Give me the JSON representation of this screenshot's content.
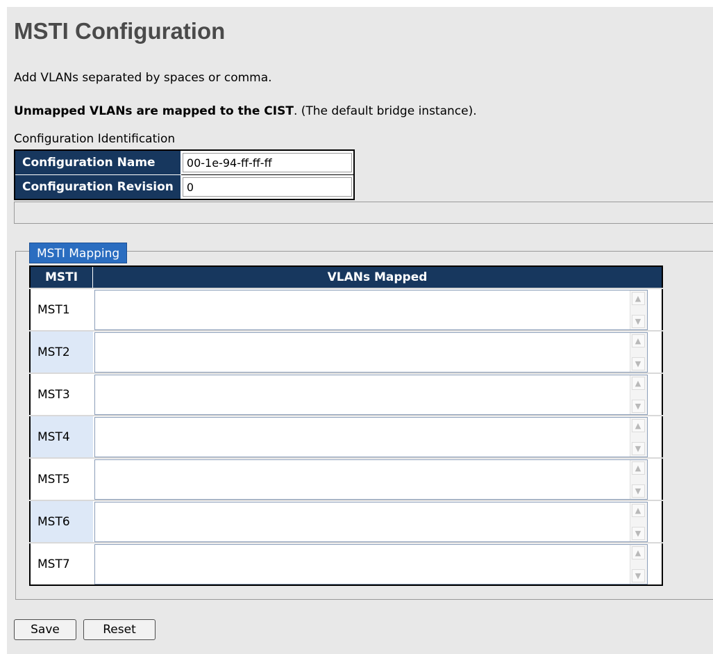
{
  "page": {
    "title": "MSTI Configuration",
    "note_add": "Add VLANs separated by spaces or comma.",
    "note_unmapped_bold": "Unmapped VLANs are mapped to the CIST",
    "note_unmapped_rest": ". (The default bridge instance)."
  },
  "config_identification": {
    "caption": "Configuration Identification",
    "name_label": "Configuration Name",
    "name_value": "00-1e-94-ff-ff-ff",
    "revision_label": "Configuration Revision",
    "revision_value": "0"
  },
  "msti_mapping": {
    "legend": "MSTI Mapping",
    "col_msti": "MSTI",
    "col_vlans": "VLANs Mapped",
    "rows": [
      {
        "msti": "MST1",
        "vlans": ""
      },
      {
        "msti": "MST2",
        "vlans": ""
      },
      {
        "msti": "MST3",
        "vlans": ""
      },
      {
        "msti": "MST4",
        "vlans": ""
      },
      {
        "msti": "MST5",
        "vlans": ""
      },
      {
        "msti": "MST6",
        "vlans": ""
      },
      {
        "msti": "MST7",
        "vlans": ""
      }
    ]
  },
  "buttons": {
    "save": "Save",
    "reset": "Reset"
  },
  "icons": {
    "scroll_up": "chevron-up-icon",
    "scroll_down": "chevron-down-icon"
  },
  "colors": {
    "header_bg": "#17375e",
    "legend_bg": "#2a6dc0",
    "row_alt_bg": "#dde8f7",
    "page_bg": "#e8e8e8"
  }
}
